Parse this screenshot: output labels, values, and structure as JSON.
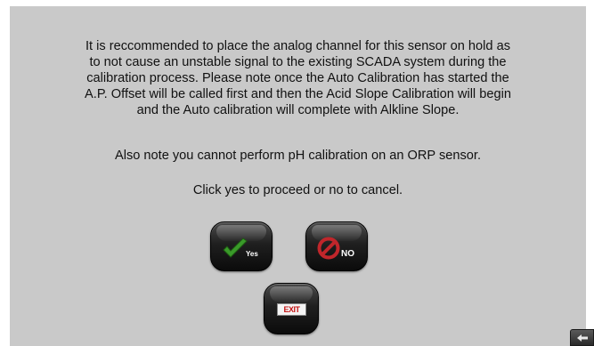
{
  "dialog": {
    "message_lines": [
      "It is reccommended to place the analog channel for this sensor on hold as",
      "to not cause an unstable signal to the existing SCADA system during the",
      "calibration process. Please note once the Auto Calibration has started the",
      "A.P. Offset will be called first and then the Acid Slope Calibration will begin",
      "and the Auto calibration will complete with Alkline Slope."
    ],
    "note": "Also note you cannot perform pH calibration on an ORP sensor.",
    "prompt": "Click yes to proceed or no to cancel."
  },
  "buttons": {
    "yes": {
      "label": "Yes",
      "icon": "green-check-icon",
      "color": "#3a9a2a"
    },
    "no": {
      "label": "NO",
      "icon": "red-no-symbol-icon",
      "color": "#c0262b"
    },
    "exit": {
      "label": "EXIT",
      "icon": "exit-sign-icon",
      "color": "#c31515"
    },
    "corner": {
      "icon": "back-arrow-icon"
    }
  },
  "colors": {
    "panel_background": "#c9c9c9",
    "page_background": "#ffffff",
    "text": "#111111"
  }
}
